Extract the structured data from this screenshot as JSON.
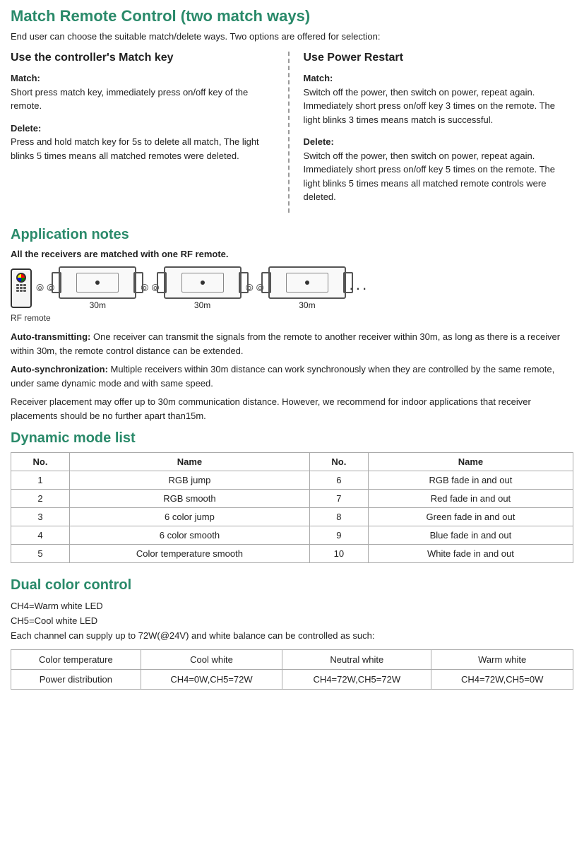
{
  "page": {
    "title": "Match Remote Control (two match ways)",
    "intro": "End user can choose the suitable match/delete ways. Two options are offered for selection:"
  },
  "match_controller": {
    "heading": "Use the controller's Match key",
    "match_label": "Match:",
    "match_text": "Short press match key, immediately press on/off key of the remote.",
    "delete_label": "Delete:",
    "delete_text": "Press and hold match key for 5s to delete all match, The light blinks 5 times means all matched remotes were deleted."
  },
  "match_power": {
    "heading": "Use Power Restart",
    "match_label": "Match:",
    "match_text": "Switch off the power, then switch on power, repeat again. Immediately short press on/off key 3 times on the remote. The light blinks 3 times means match is successful.",
    "delete_label": "Delete:",
    "delete_text": "Switch off the power, then switch on power, repeat again. Immediately short press on/off key 5 times on the remote. The light blinks 5 times means all matched remote controls were deleted."
  },
  "application_notes": {
    "title": "Application notes",
    "note_text": "All the receivers are matched with one RF remote.",
    "dist1": "30m",
    "dist2": "30m",
    "dist3": "30m",
    "rf_label": "RF remote",
    "auto_transmitting_label": "Auto-transmitting:",
    "auto_transmitting_text": " One receiver can transmit the signals from the remote to another receiver within 30m, as long as there is a receiver within 30m, the remote control distance can be extended.",
    "auto_sync_label": "Auto-synchronization:",
    "auto_sync_text": " Multiple receivers within 30m distance can work synchronously when they are controlled by the same remote, under same dynamic mode and with same speed.",
    "placement_text": "Receiver placement may offer up to 30m communication distance. However, we recommend for indoor applications that receiver placements should be no further apart than15m."
  },
  "dynamic_mode": {
    "title": "Dynamic mode list",
    "columns": [
      "No.",
      "Name",
      "No.",
      "Name"
    ],
    "rows": [
      {
        "no1": "1",
        "name1": "RGB jump",
        "no2": "6",
        "name2": "RGB fade in and out"
      },
      {
        "no1": "2",
        "name1": "RGB smooth",
        "no2": "7",
        "name2": "Red fade in and out"
      },
      {
        "no1": "3",
        "name1": "6 color jump",
        "no2": "8",
        "name2": "Green fade in and out"
      },
      {
        "no1": "4",
        "name1": "6 color smooth",
        "no2": "9",
        "name2": "Blue fade in and out"
      },
      {
        "no1": "5",
        "name1": "Color temperature smooth",
        "no2": "10",
        "name2": "White fade in and out"
      }
    ]
  },
  "dual_color": {
    "title": "Dual color control",
    "line1": "CH4=Warm white LED",
    "line2": "CH5=Cool white LED",
    "line3": "Each channel can supply up to 72W(@24V) and white balance can be controlled as such:",
    "table_headers": [
      "Color temperature",
      "Cool white",
      "Neutral white",
      "Warm white"
    ],
    "table_rows": [
      {
        "label": "Power distribution",
        "cool": "CH4=0W,CH5=72W",
        "neutral": "CH4=72W,CH5=72W",
        "warm": "CH4=72W,CH5=0W"
      }
    ]
  }
}
